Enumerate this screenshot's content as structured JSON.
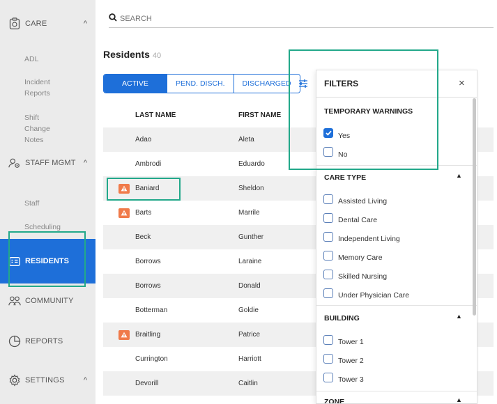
{
  "sidebar": {
    "care": {
      "label": "CARE",
      "chevron": "^"
    },
    "care_items": [
      "ADL",
      "Incident Reports",
      "Shift Change Notes"
    ],
    "staff": {
      "label": "STAFF MGMT",
      "chevron": "^"
    },
    "staff_items": [
      "Staff",
      "Scheduling"
    ],
    "residents": {
      "label": "RESIDENTS"
    },
    "community": {
      "label": "COMMUNITY"
    },
    "reports": {
      "label": "REPORTS"
    },
    "settings": {
      "label": "SETTINGS",
      "chevron": "^"
    }
  },
  "search": {
    "placeholder": "SEARCH"
  },
  "page": {
    "title": "Residents",
    "count": "40"
  },
  "tabs": [
    "ACTIVE",
    "PEND. DISCH.",
    "DISCHARGED"
  ],
  "table": {
    "headers": {
      "last": "LAST NAME",
      "first": "FIRST NAME"
    },
    "rows": [
      {
        "last": "Adao",
        "first": "Aleta",
        "warning": false
      },
      {
        "last": "Ambrodi",
        "first": "Eduardo",
        "warning": false
      },
      {
        "last": "Baniard",
        "first": "Sheldon",
        "warning": true
      },
      {
        "last": "Barts",
        "first": "Marrile",
        "warning": true
      },
      {
        "last": "Beck",
        "first": "Gunther",
        "warning": false
      },
      {
        "last": "Borrows",
        "first": "Laraine",
        "warning": false
      },
      {
        "last": "Borrows",
        "first": "Donald",
        "warning": false
      },
      {
        "last": "Botterman",
        "first": "Goldie",
        "warning": false
      },
      {
        "last": "Braitling",
        "first": "Patrice",
        "warning": true
      },
      {
        "last": "Currington",
        "first": "Harriott",
        "warning": false
      },
      {
        "last": "Devorill",
        "first": "Caitlin",
        "warning": false
      }
    ]
  },
  "filters": {
    "title": "FILTERS",
    "close": "×",
    "temporary_warnings": {
      "heading": "TEMPORARY WARNINGS",
      "options": [
        {
          "label": "Yes",
          "checked": true
        },
        {
          "label": "No",
          "checked": false
        }
      ]
    },
    "care_type": {
      "heading": "CARE TYPE",
      "options": [
        "Assisted Living",
        "Dental Care",
        "Independent Living",
        "Memory Care",
        "Skilled Nursing",
        "Under Physician Care"
      ]
    },
    "building": {
      "heading": "BUILDING",
      "options": [
        "Tower 1",
        "Tower 2",
        "Tower 3"
      ]
    },
    "zone": {
      "heading": "ZONE"
    }
  },
  "colors": {
    "accent": "#1e6fd9",
    "highlight": "#22a88a",
    "warning": "#f07a4a"
  }
}
